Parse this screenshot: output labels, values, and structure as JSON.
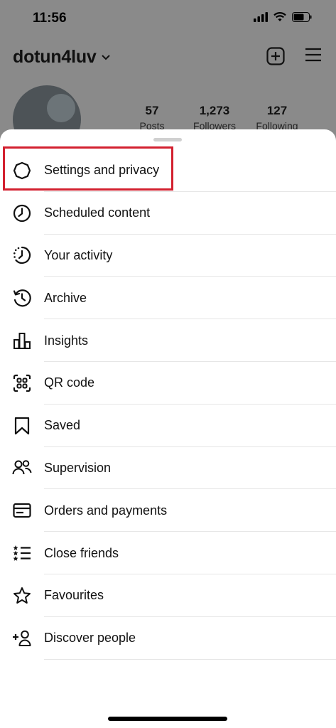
{
  "status_bar": {
    "time": "11:56"
  },
  "profile": {
    "username": "dotun4luv",
    "stats": [
      {
        "value": "57",
        "label": "Posts"
      },
      {
        "value": "1,273",
        "label": "Followers"
      },
      {
        "value": "127",
        "label": "Following"
      }
    ]
  },
  "menu": {
    "items": [
      {
        "label": "Settings and privacy",
        "icon": "settings-icon"
      },
      {
        "label": "Scheduled content",
        "icon": "clock-icon"
      },
      {
        "label": "Your activity",
        "icon": "activity-icon"
      },
      {
        "label": "Archive",
        "icon": "archive-icon"
      },
      {
        "label": "Insights",
        "icon": "insights-icon"
      },
      {
        "label": "QR code",
        "icon": "qr-code-icon"
      },
      {
        "label": "Saved",
        "icon": "bookmark-icon"
      },
      {
        "label": "Supervision",
        "icon": "supervision-icon"
      },
      {
        "label": "Orders and payments",
        "icon": "card-icon"
      },
      {
        "label": "Close friends",
        "icon": "close-friends-icon"
      },
      {
        "label": "Favourites",
        "icon": "star-icon"
      },
      {
        "label": "Discover people",
        "icon": "add-person-icon"
      }
    ]
  },
  "colors": {
    "highlight": "#d3202f",
    "overlay": "#8a8a8a"
  }
}
